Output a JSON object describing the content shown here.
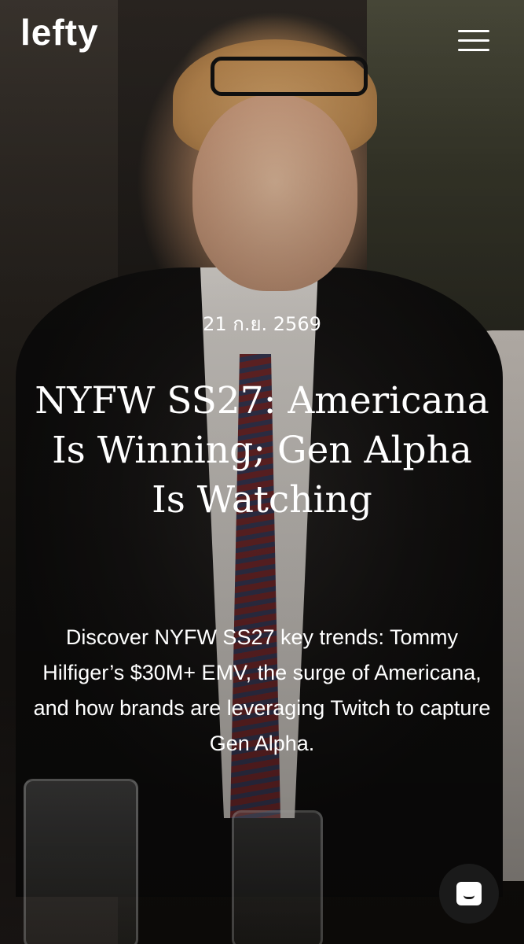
{
  "header": {
    "logo_text": "lefty",
    "menu_icon": "hamburger-menu-icon"
  },
  "article": {
    "date": "21 ก.ย. 2569",
    "title": "NYFW SS27: Americana Is Winning; Gen Alpha Is Watching",
    "description": "Discover NYFW SS27 key trends: Tommy Hilfiger’s $30M+ EMV, the surge of Americana, and how brands are leveraging Twitch to capture Gen Alpha."
  },
  "chat": {
    "icon": "chat-bubble-icon"
  },
  "colors": {
    "text": "#ffffff",
    "chat_button_bg": "#1a1a1a"
  }
}
